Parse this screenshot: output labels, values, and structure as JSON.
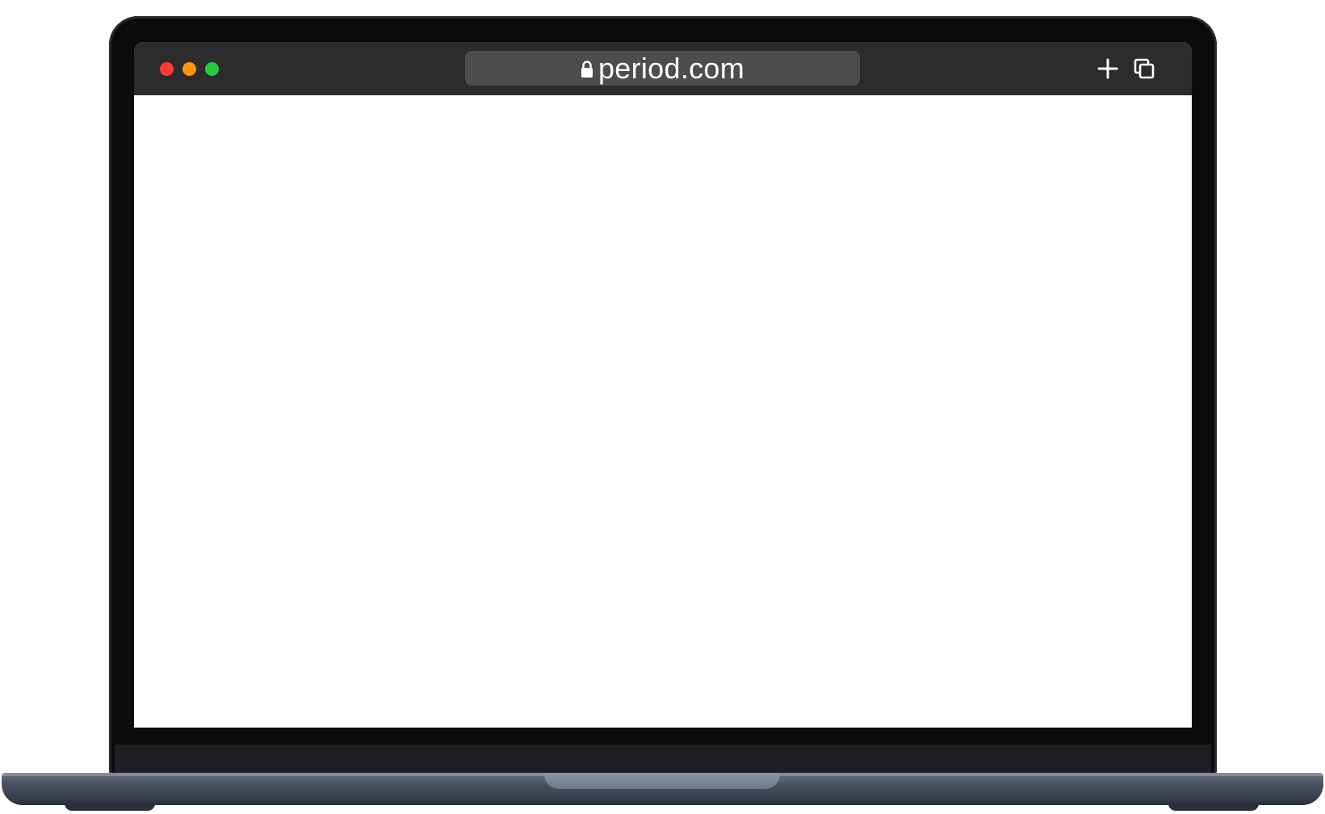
{
  "browser": {
    "url": "period.com",
    "secure_icon": "lock-icon",
    "traffic_lights": {
      "close_color": "#ff3b30",
      "minimize_color": "#ff9500",
      "maximize_color": "#28c840"
    },
    "toolbar_icons": [
      "plus-icon",
      "tabs-icon"
    ]
  },
  "colors": {
    "titlebar": "#2c2c2e",
    "addressbar": "#4d4d50",
    "bezel": "#0b0b0c",
    "base": "#4a5262"
  }
}
